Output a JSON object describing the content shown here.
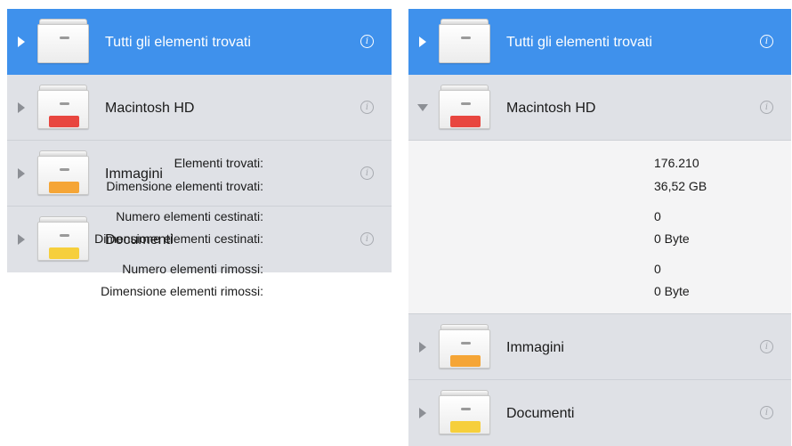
{
  "left_panel": {
    "items": [
      {
        "title": "Tutti gli elementi trovati",
        "state": "selected",
        "drawer_label_color": "#ffffff",
        "info_icon": "info-icon"
      },
      {
        "title": "Macintosh HD",
        "state": "collapsed",
        "drawer_label_color": "#e8463f",
        "info_icon": "info-icon"
      },
      {
        "title": "Immagini",
        "state": "collapsed",
        "drawer_label_color": "#f5a536",
        "info_icon": "info-icon"
      },
      {
        "title": "Documenti",
        "state": "collapsed",
        "drawer_label_color": "#f6cf3c",
        "info_icon": "info-icon"
      }
    ]
  },
  "right_panel": {
    "items": [
      {
        "title": "Tutti gli elementi trovati",
        "state": "selected",
        "drawer_label_color": "#ffffff"
      },
      {
        "title": "Macintosh HD",
        "state": "expanded",
        "drawer_label_color": "#e8463f"
      },
      {
        "title": "Immagini",
        "state": "collapsed",
        "drawer_label_color": "#f5a536"
      },
      {
        "title": "Documenti",
        "state": "collapsed",
        "drawer_label_color": "#f6cf3c"
      }
    ],
    "details": [
      {
        "label": "Elementi trovati:",
        "value": "176.210"
      },
      {
        "label": "Dimensione elementi trovati:",
        "value": "36,52 GB"
      },
      {
        "label": "Numero elementi cestinati:",
        "value": "0"
      },
      {
        "label": "Dimensione elementi cestinati:",
        "value": "0 Byte"
      },
      {
        "label": "Numero elementi rimossi:",
        "value": "0"
      },
      {
        "label": "Dimensione elementi rimossi:",
        "value": "0 Byte"
      }
    ]
  },
  "colors": {
    "selection": "#3f91ec",
    "panel_background": "#dfe1e6",
    "details_background": "#f4f4f5"
  }
}
